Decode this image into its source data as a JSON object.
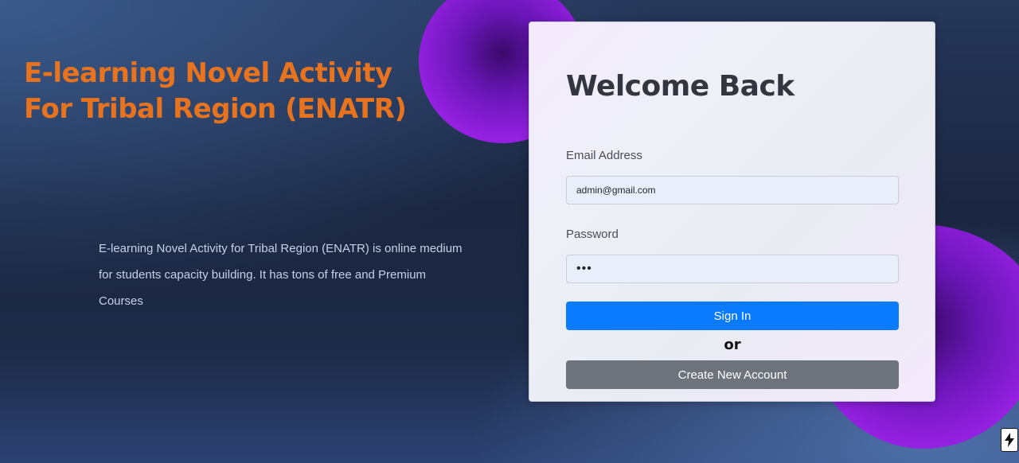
{
  "hero": {
    "title_line1": "E-learning Novel Activity",
    "title_line2": "For Tribal Region (ENATR)",
    "description_line1": "E-learning Novel Activity for Tribal Region (ENATR) is online medium",
    "description_line2": "for students capacity building. It has tons of free and Premium",
    "description_line3": "Courses"
  },
  "login": {
    "title": "Welcome Back",
    "email_label": "Email Address",
    "email_value": "admin@gmail.com",
    "password_label": "Password",
    "password_value": "•••",
    "signin_label": "Sign In",
    "or_text": "or",
    "create_account_label": "Create New Account"
  },
  "corner_badge": {
    "icon": "lightning-bolt-icon"
  },
  "colors": {
    "accent_orange": "#e8731e",
    "primary_blue": "#0a7bff",
    "secondary_gray": "#6c737c",
    "blob_purple": "#9420e0"
  }
}
